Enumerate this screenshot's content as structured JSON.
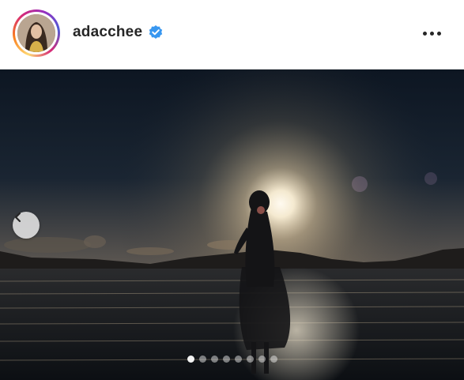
{
  "post": {
    "username": "adacchee",
    "verified": true,
    "avatar_icon": "profile-photo",
    "more_icon": "more-horizontal-icon"
  },
  "carousel": {
    "prev_icon": "chevron-left-icon",
    "total_slides": 8,
    "active_slide": 1
  },
  "colors": {
    "verified_blue": "#3897f0",
    "header_bg": "#ffffff",
    "text_primary": "#262626"
  }
}
